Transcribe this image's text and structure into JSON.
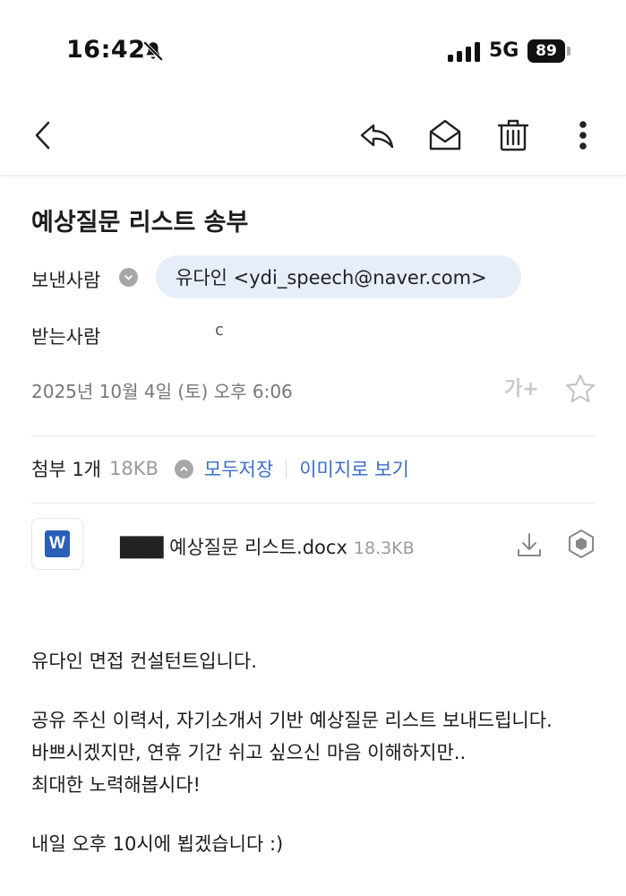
{
  "status_bar": {
    "time": "16:42",
    "network": "5G",
    "battery": "89"
  },
  "toolbar": {
    "icons": [
      "back-icon",
      "reply-icon",
      "mark-unread-icon",
      "trash-icon",
      "more-icon"
    ]
  },
  "mail": {
    "subject": "예상질문 리스트 송부",
    "sender_label": "보낸사람",
    "sender": "유다인 <ydi_speech@naver.com>",
    "recipient_label": "받는사람",
    "recipient": "c",
    "date": "2025년 10월 4일 (토) 오후 6:06",
    "font_size_label": "가+"
  },
  "attachments": {
    "label": "첨부 1개",
    "total_size": "18KB",
    "save_all": "모두저장",
    "view_as_image": "이미지로 보기",
    "files": [
      {
        "name": "███ 예상질문 리스트.docx",
        "size": "18.3KB"
      }
    ]
  },
  "body": {
    "lines": [
      "유다인 면접 컨설턴트입니다.",
      "",
      "공유 주신 이력서, 자기소개서 기반 예상질문 리스트 보내드립니다.",
      "바쁘시겠지만, 연휴 기간 쉬고 싶으신 마음 이해하지만..",
      "최대한 노력해봅시다!",
      "",
      "내일 오후 10시에 뵙겠습니다 :)"
    ]
  },
  "colors": {
    "accent": "#3b6ec7",
    "chip": "#e6eef9",
    "word": "#2b5fb8"
  }
}
